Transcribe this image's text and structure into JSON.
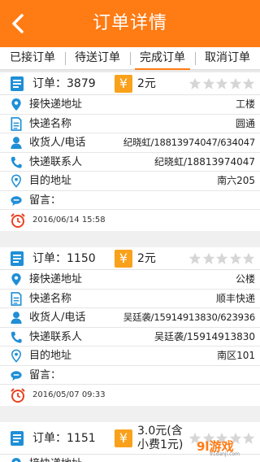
{
  "header": {
    "title": "订单详情"
  },
  "tabs": [
    {
      "label": "已接订单"
    },
    {
      "label": "待送订单"
    },
    {
      "label": "完成订单"
    },
    {
      "label": "取消订单"
    }
  ],
  "active_tab": 2,
  "labels": {
    "order_prefix": "订单：",
    "pickup": "接快递地址",
    "courier": "快递名称",
    "receiver": "收货人/电话",
    "contact": "快递联系人",
    "destination": "目的地址",
    "message": "留言："
  },
  "orders": [
    {
      "number": "3879",
      "price": "2元",
      "rating": 0,
      "pickup": "工楼",
      "courier": "圆通",
      "receiver": "纪晓虹/18813974047/634047",
      "contact": "纪晓虹/18813974047",
      "destination": "南六205",
      "message": "",
      "time": "2016/06/14   15:58"
    },
    {
      "number": "1150",
      "price": "2元",
      "rating": 0,
      "pickup": "公楼",
      "courier": "顺丰快递",
      "receiver": "吴廷袭/15914913830/623936",
      "contact": "吴廷袭/15914913830",
      "destination": "南区101",
      "message": "",
      "time": "2016/05/07   09:33"
    },
    {
      "number": "1151",
      "price_line1": "3.0元(含",
      "price_line2": "小费1元)",
      "rating": 0,
      "pickup": ""
    }
  ],
  "watermark": {
    "logo": "9l游戏",
    "url": "91danji.com"
  },
  "colors": {
    "accent": "#ff7b14",
    "icon_blue": "#1f8fd6",
    "clock_red": "#e8411f",
    "yen_bg": "#f9a11b",
    "star_empty": "#d6d6d6"
  }
}
